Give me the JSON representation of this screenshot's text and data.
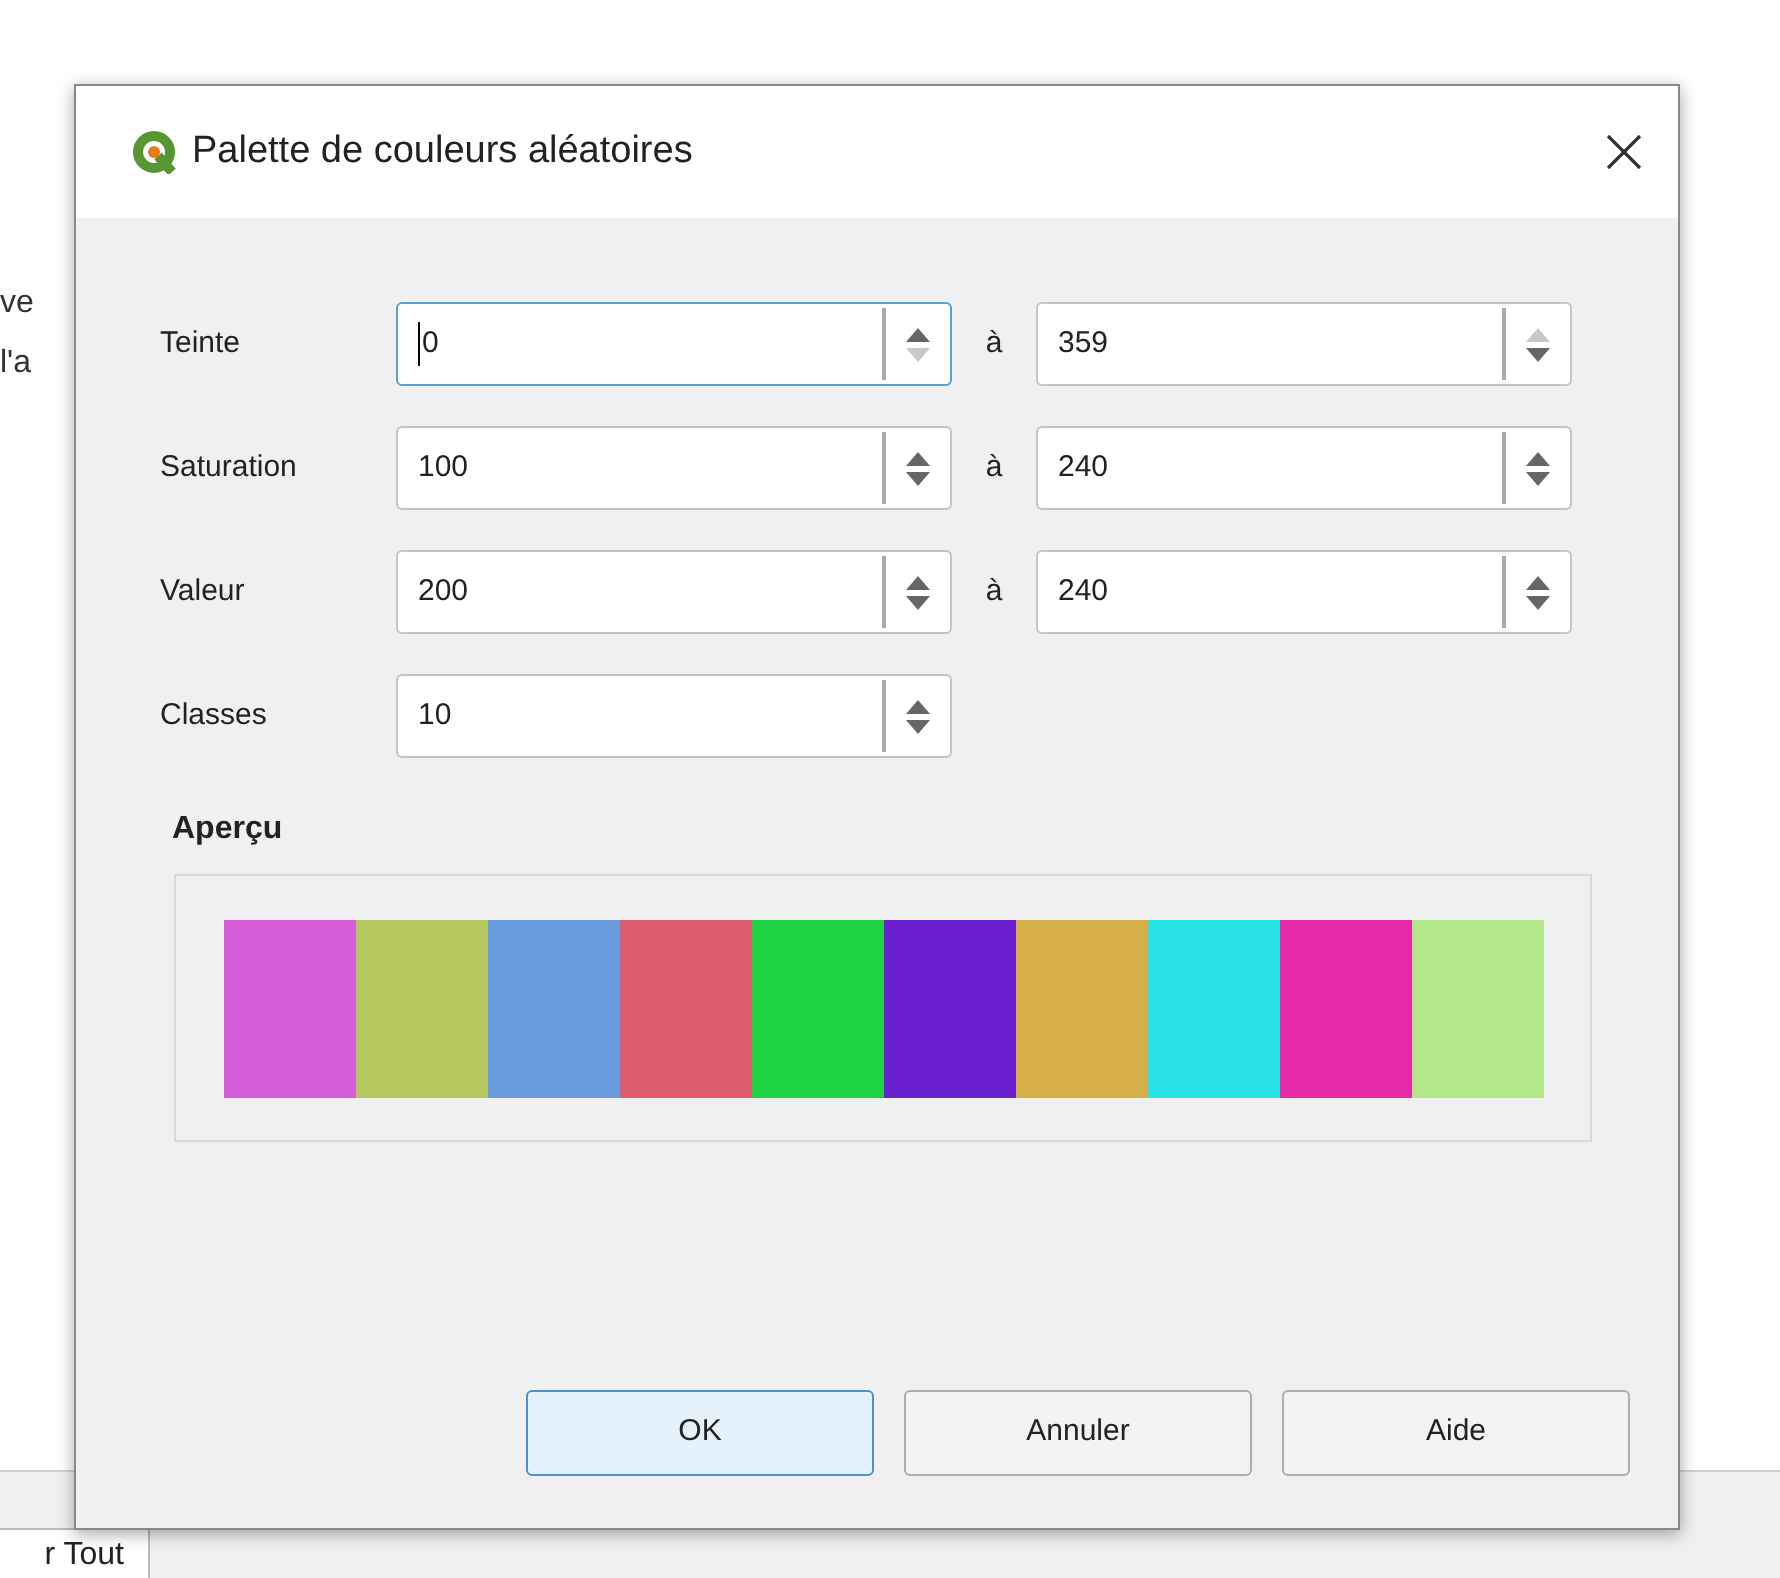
{
  "background": {
    "texts": [
      "ve",
      "l'a"
    ],
    "tab": "r Tout"
  },
  "window": {
    "title": "Palette de couleurs aléatoires"
  },
  "rows": [
    {
      "label": "Teinte",
      "from": {
        "value": "0",
        "focused": true,
        "up_disabled": false,
        "down_disabled": true
      },
      "to_label": "à",
      "to": {
        "value": "359",
        "focused": false,
        "up_disabled": true,
        "down_disabled": false
      }
    },
    {
      "label": "Saturation",
      "from": {
        "value": "100",
        "focused": false,
        "up_disabled": false,
        "down_disabled": false
      },
      "to_label": "à",
      "to": {
        "value": "240",
        "focused": false,
        "up_disabled": false,
        "down_disabled": false
      }
    },
    {
      "label": "Valeur",
      "from": {
        "value": "200",
        "focused": false,
        "up_disabled": false,
        "down_disabled": false
      },
      "to_label": "à",
      "to": {
        "value": "240",
        "focused": false,
        "up_disabled": false,
        "down_disabled": false
      }
    },
    {
      "label": "Classes",
      "from": {
        "value": "10",
        "focused": false,
        "up_disabled": false,
        "down_disabled": false
      }
    }
  ],
  "preview": {
    "title": "Aperçu",
    "swatches": [
      {
        "color": "#d65fd9"
      },
      {
        "color": "#b4c85f"
      },
      {
        "color": "#6a9de0"
      },
      {
        "color": "#dc5e6e"
      },
      {
        "color": "#1fd444"
      },
      {
        "color": "#6a1fd0"
      },
      {
        "color": "#d8b04a"
      },
      {
        "color": "#28e2e6"
      },
      {
        "color": "#e82aa8"
      },
      {
        "color": "#b2e889"
      }
    ]
  },
  "buttons": [
    {
      "label": "OK",
      "default": true
    },
    {
      "label": "Annuler",
      "default": false
    },
    {
      "label": "Aide",
      "default": false
    }
  ]
}
